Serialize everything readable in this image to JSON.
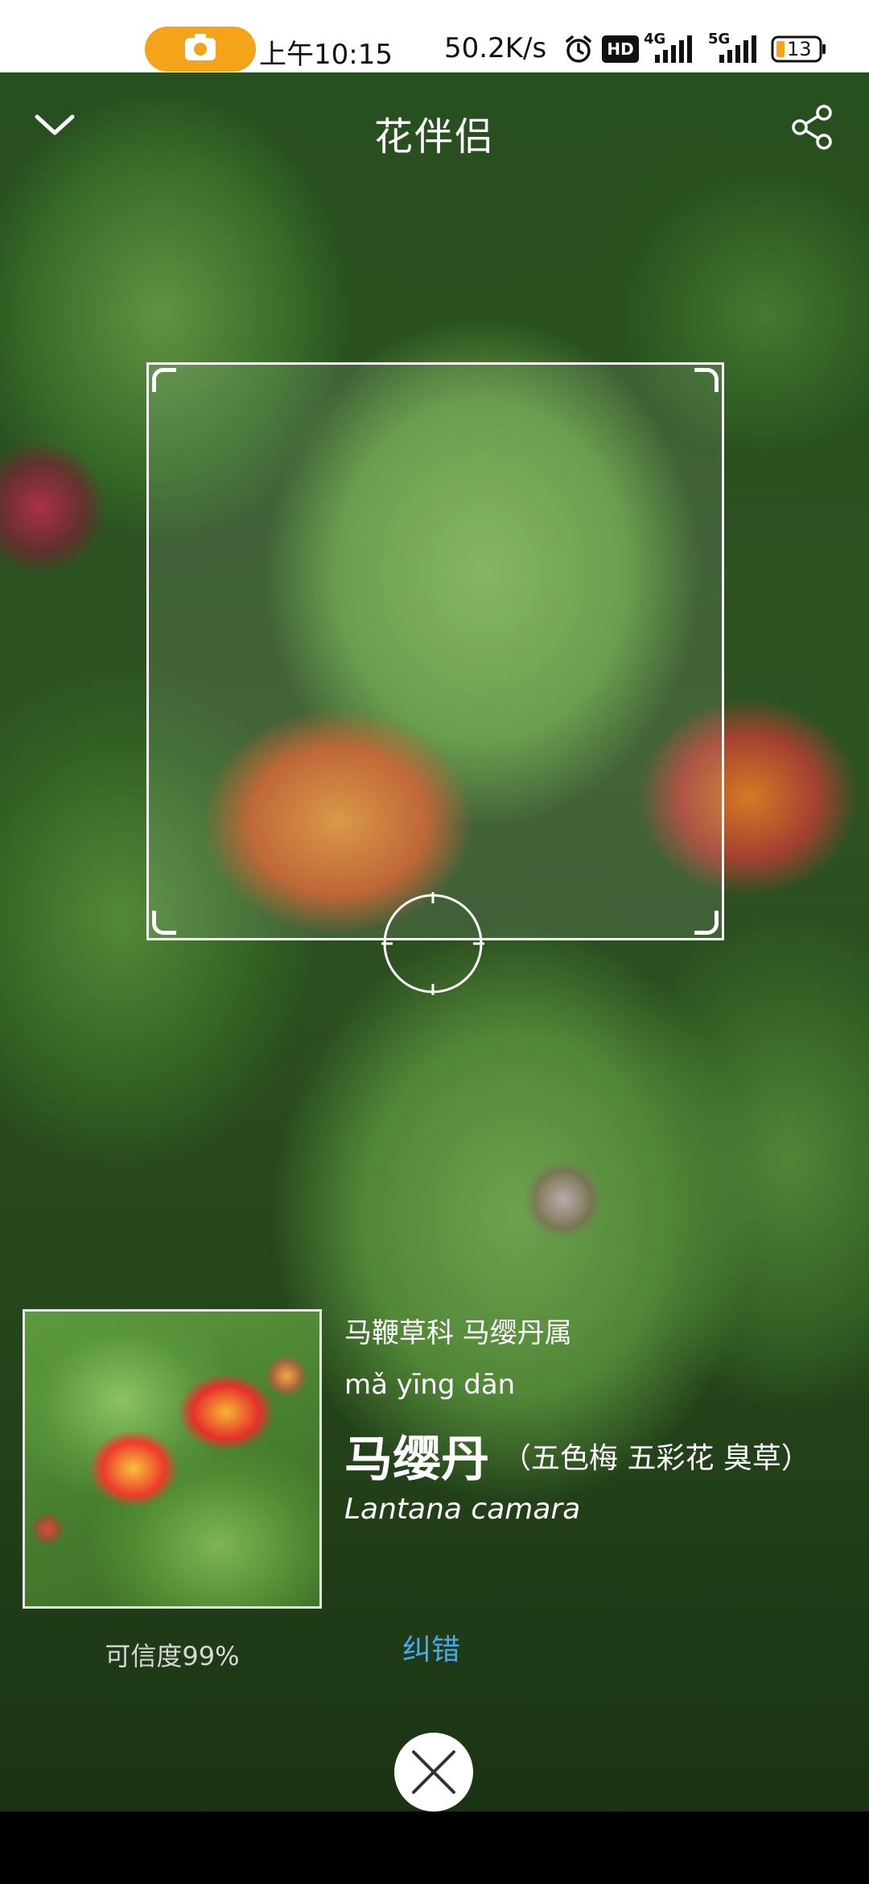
{
  "status_bar": {
    "time": "上午10:15",
    "net_speed": "50.2K/s",
    "battery_level": "13",
    "pill_color": "#f5a31a",
    "icons": [
      "camera-icon",
      "alarm-icon",
      "hd-icon",
      "signal-4g-icon",
      "signal-5g-icon",
      "battery-icon"
    ],
    "net_labels": {
      "hd": "HD",
      "g4": "4G",
      "g5": "5G"
    }
  },
  "header": {
    "title": "花伴侣"
  },
  "result": {
    "family_genus": "马鞭草科 马缨丹属",
    "pinyin": "mǎ yīng dān",
    "name": "马缨丹",
    "alias": "（五色梅 五彩花 臭草）",
    "latin": "Lantana camara",
    "confidence": "可信度99%",
    "correct_label": "纠错"
  },
  "colors": {
    "link": "#4aa8f0",
    "accent": "#f5a31a"
  }
}
